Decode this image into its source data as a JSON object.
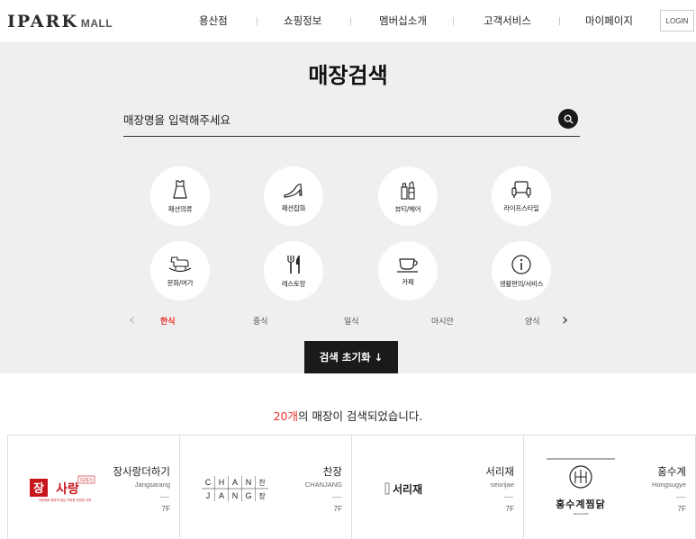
{
  "header": {
    "logo_main": "IPARK",
    "logo_sub": "MALL",
    "nav": [
      "용산점",
      "쇼핑정보",
      "멤버십소개",
      "고객서비스",
      "마이페이지"
    ],
    "login": "LOGIN"
  },
  "search": {
    "title": "매장검색",
    "placeholder": "매장명을 입력해주세요",
    "categories": [
      {
        "label": "패션의류",
        "icon": "dress-icon"
      },
      {
        "label": "패션잡화",
        "icon": "heel-shoe-icon"
      },
      {
        "label": "뷰티/헤어",
        "icon": "cosmetics-icon"
      },
      {
        "label": "라이프스타일",
        "icon": "armchair-icon"
      },
      {
        "label": "문화/여가",
        "icon": "rocking-horse-icon"
      },
      {
        "label": "레스토랑",
        "icon": "fork-knife-icon"
      },
      {
        "label": "카페",
        "icon": "coffee-cup-icon"
      },
      {
        "label": "생활편의/서비스",
        "icon": "info-icon"
      }
    ],
    "subcategories": [
      "한식",
      "중식",
      "일식",
      "아시안",
      "양식"
    ],
    "active_subcategory": "한식",
    "reset_label": "검색 초기화 ↓"
  },
  "results": {
    "count_num": "20개",
    "count_text": "의 매장이 검색되었습니다.",
    "stores": [
      {
        "name": "장사랑더하기",
        "en": "Jangsarang",
        "floor": "7F",
        "logo_text": "장사랑",
        "logo_small": "더하기",
        "logo_sub": "착한재료 엄마의 정성 가득한 건강한 식탁"
      },
      {
        "name": "찬장",
        "en": "CHANJANG",
        "floor": "7F",
        "logo_text": "CHANJANG",
        "logo_letters_top": [
          "C",
          "H",
          "A",
          "N",
          "찬"
        ],
        "logo_letters_bottom": [
          "J",
          "A",
          "N",
          "G",
          "장"
        ]
      },
      {
        "name": "서리재",
        "en": "seorijae",
        "floor": "7F",
        "logo_text": "서리재"
      },
      {
        "name": "홍수계",
        "en": "Hongsugye",
        "floor": "7F",
        "logo_text": "홍수계찜닭",
        "logo_small": "SINCE 2008"
      }
    ]
  },
  "colors": {
    "accent": "#e8332a",
    "dark": "#1a1a1a",
    "search_bg": "#f0efef"
  }
}
